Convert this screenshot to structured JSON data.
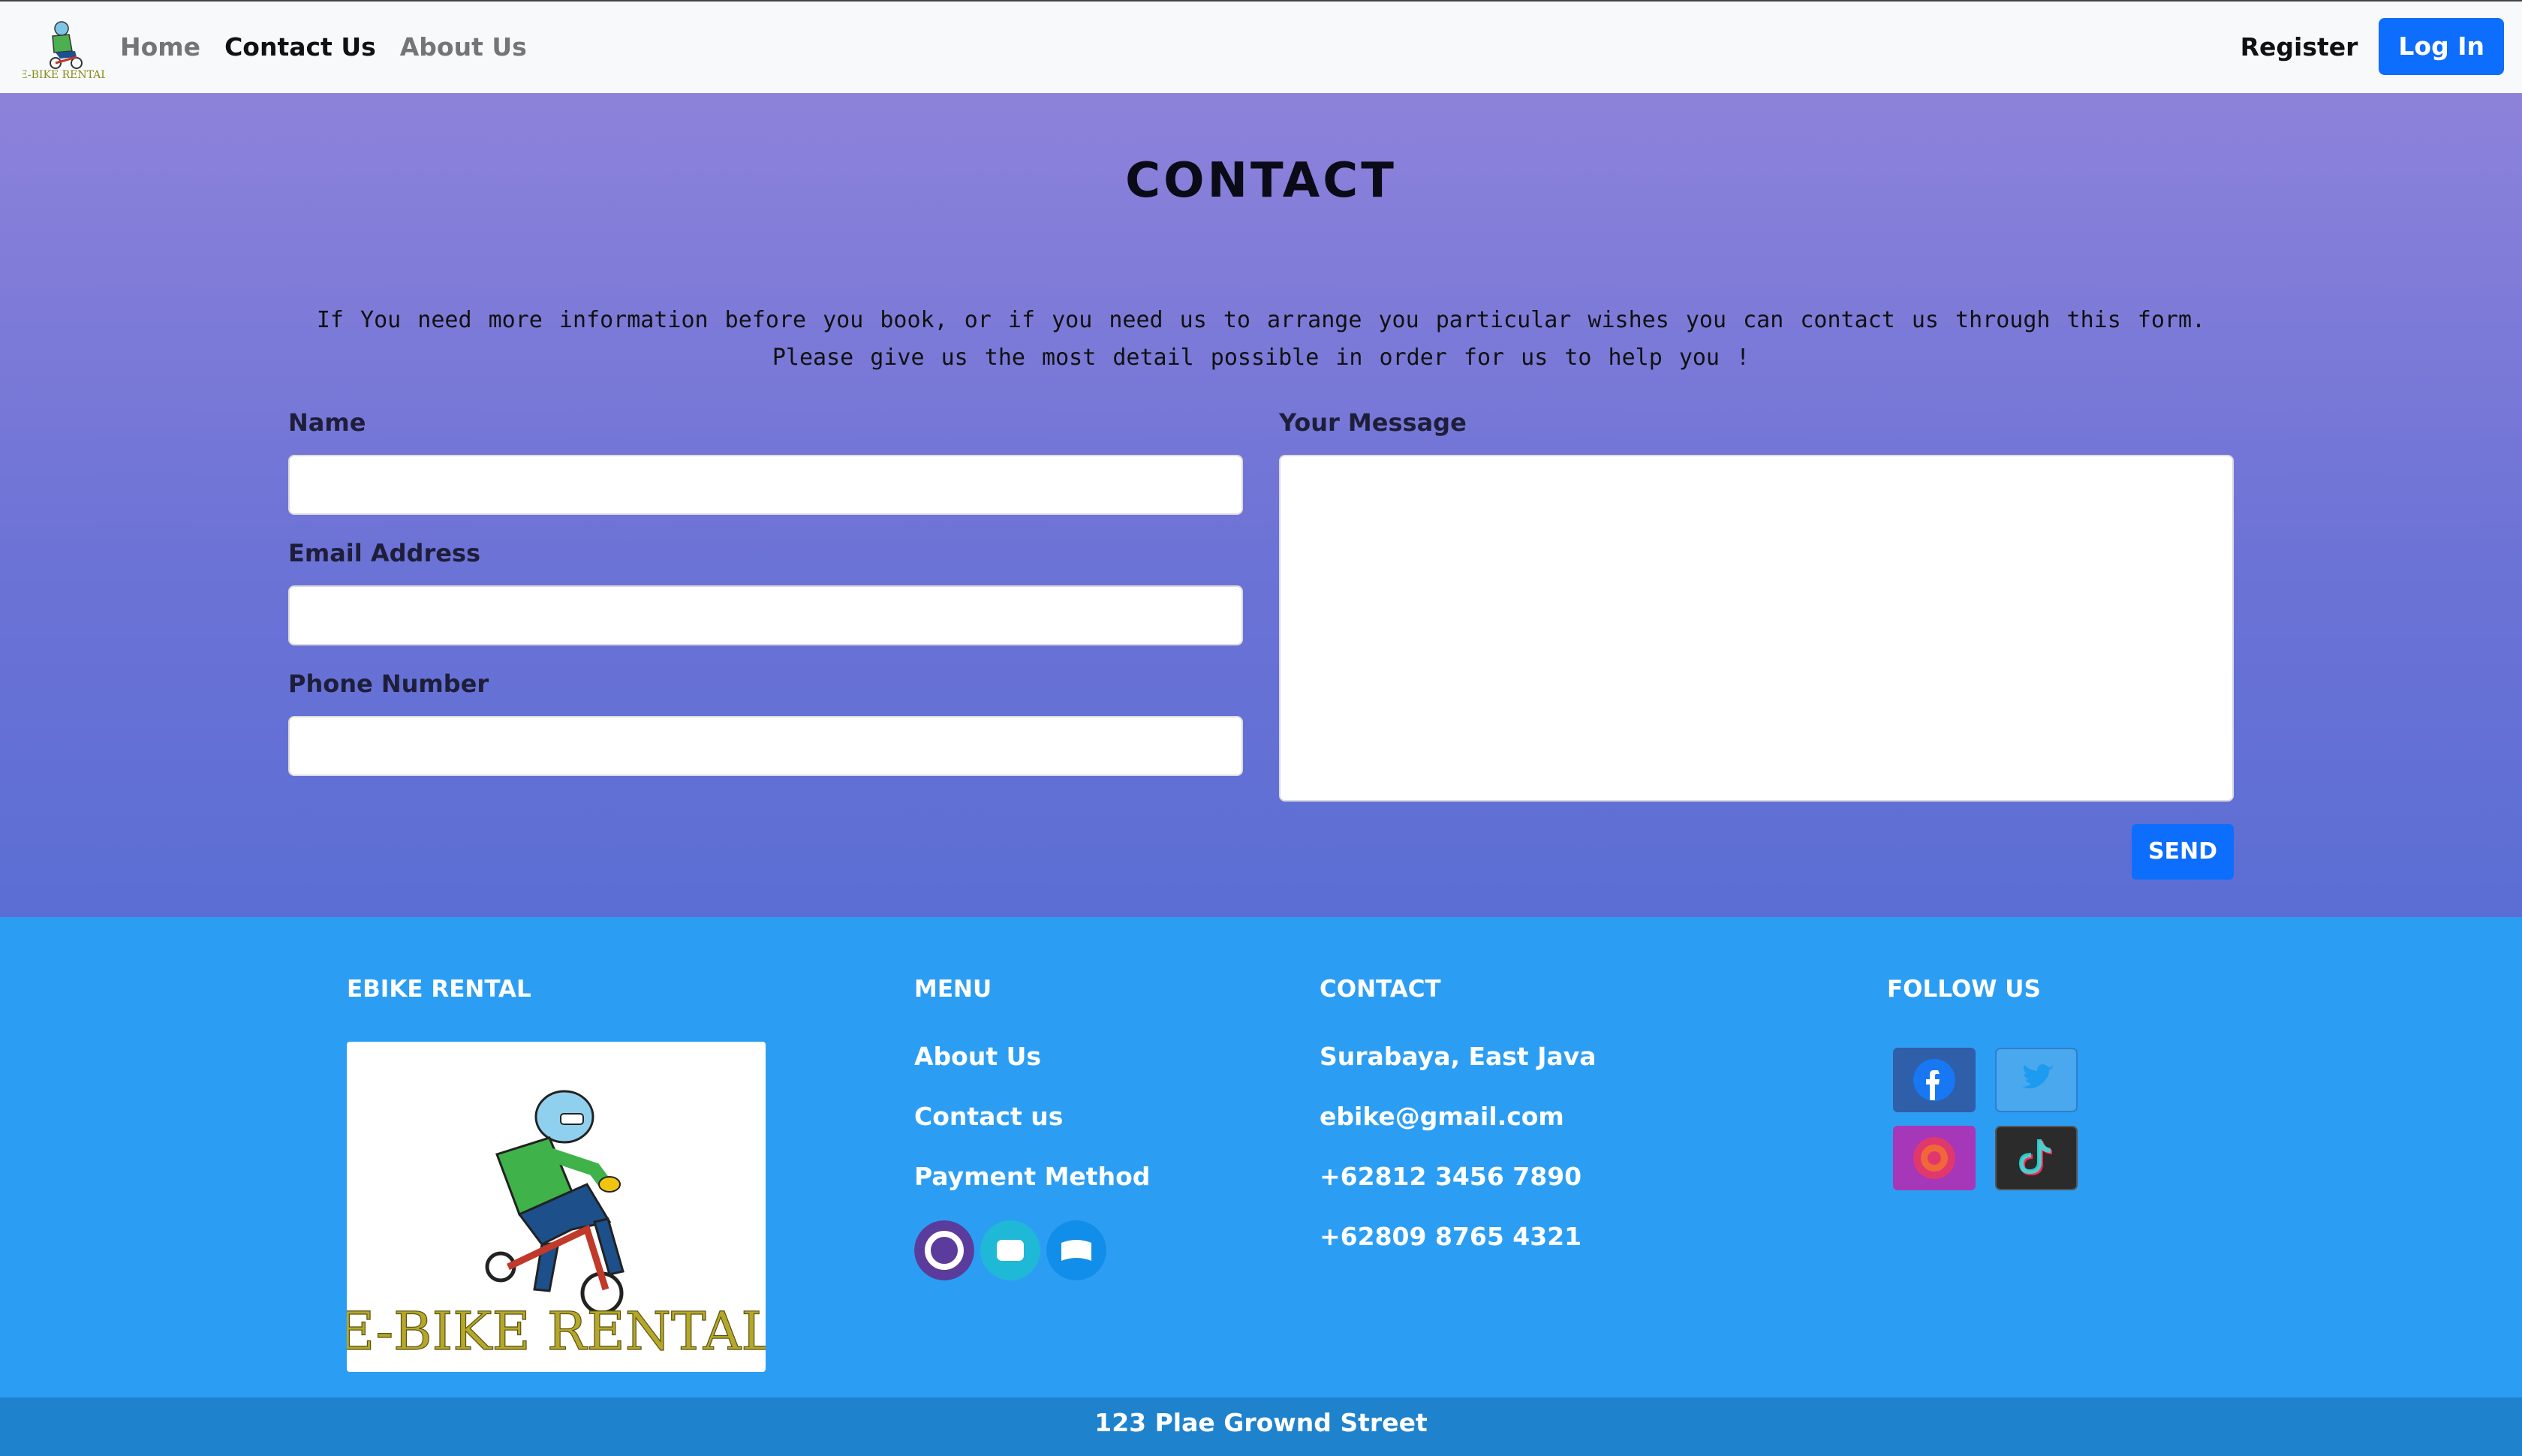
{
  "nav": {
    "logo_text": "E-BIKE RENTAL",
    "links": [
      "Home",
      "Contact Us",
      "About Us"
    ],
    "active": "Contact Us",
    "register": "Register",
    "login": "Log In"
  },
  "contact": {
    "title": "CONTACT",
    "intro_line1": "If You need more information before you book, or if you need us to arrange you particular wishes you can contact us through this form.",
    "intro_line2": "Please give us the most detail possible in order for us to help you !",
    "name_label": "Name",
    "name_value": "",
    "email_label": "Email Address",
    "email_value": "",
    "phone_label": "Phone Number",
    "phone_value": "",
    "message_label": "Your Message",
    "message_value": "",
    "send": "SEND"
  },
  "footer": {
    "brand_heading": "EBIKE RENTAL",
    "brand_logo_text": "E-BIKE RENTAL",
    "menu_heading": "MENU",
    "menu_items": [
      "About Us",
      "Contact us",
      "Payment Method"
    ],
    "payment_icons": [
      "ovo-icon",
      "wallet-icon",
      "dana-icon"
    ],
    "contact_heading": "CONTACT",
    "contact_items": [
      "Surabaya, East Java",
      "ebike@gmail.com",
      "+62812 3456 7890",
      "+62809 8765 4321"
    ],
    "follow_heading": "FOLLOW US",
    "social_icons": [
      "facebook-icon",
      "twitter-icon",
      "instagram-icon",
      "tiktok-icon"
    ],
    "address": "123 Plae Grownd Street"
  },
  "colors": {
    "primary": "#0d6efd",
    "footer_bg": "#2b9ef4",
    "bottom_bar": "#1f82cd",
    "gradient_top": "#8d82da",
    "gradient_bottom": "#5b6ed4"
  }
}
